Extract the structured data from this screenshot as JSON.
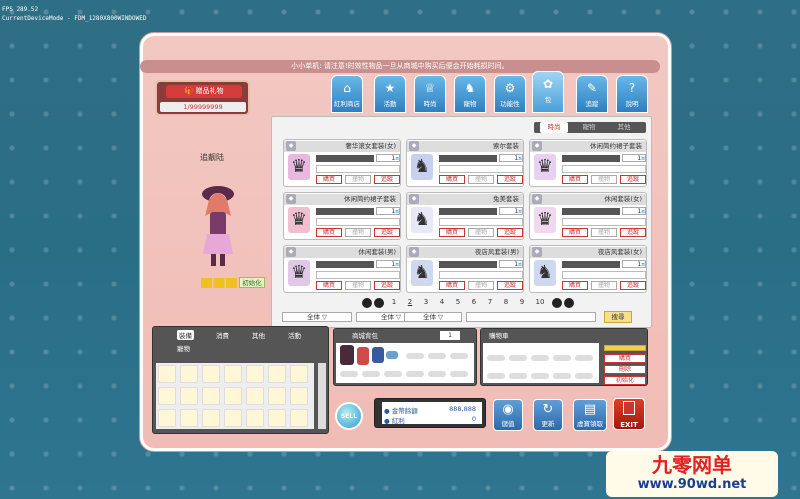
{
  "debug": {
    "fps": "FPS   289.52",
    "mode": "CurrentDeviceMode  - FDM_1280X800WINDOWED"
  },
  "notice": "小小单机: 请注意!时效性物品一旦从商城中购买后便会开始耗损时间。",
  "gift": {
    "label": "赠品礼物",
    "count": "1/99999999"
  },
  "tabs": [
    {
      "label": "紅利商店",
      "icon": "shop-icon"
    },
    {
      "label": "活動",
      "icon": "event-icon"
    },
    {
      "label": "時尚",
      "icon": "hanger-icon"
    },
    {
      "label": "寵物",
      "icon": "pet-icon"
    },
    {
      "label": "功能性",
      "icon": "gear-icon"
    },
    {
      "label": "包",
      "icon": "package-icon"
    },
    {
      "label": "追蹤",
      "icon": "bookmark-icon"
    },
    {
      "label": "說明",
      "icon": "help-icon"
    }
  ],
  "filters": [
    "時尚",
    "寵物",
    "其他"
  ],
  "items": [
    {
      "name": "奢华滚女套装(女)",
      "price": "1",
      "buy": "購買",
      "gift": "撞物",
      "track": "追蹤"
    },
    {
      "name": "索尔套装",
      "price": "1",
      "buy": "購買",
      "gift": "撞物",
      "track": "追蹤"
    },
    {
      "name": "休闲简约裙子套装",
      "price": "1",
      "buy": "購買",
      "gift": "撞物",
      "track": "追蹤"
    },
    {
      "name": "休闲简约裙子套装",
      "price": "1",
      "buy": "購買",
      "gift": "撞物",
      "track": "追蹤"
    },
    {
      "name": "兔美套装",
      "price": "1",
      "buy": "購買",
      "gift": "撞物",
      "track": "追蹤"
    },
    {
      "name": "休闲套装(女)",
      "price": "1",
      "buy": "購買",
      "gift": "撞物",
      "track": "追蹤"
    },
    {
      "name": "休闲套装(男)",
      "price": "1",
      "buy": "購買",
      "gift": "撞物",
      "track": "追蹤"
    },
    {
      "name": "夜店风套装(男)",
      "price": "1",
      "buy": "購買",
      "gift": "撞物",
      "track": "追蹤"
    },
    {
      "name": "夜店风套装(女)",
      "price": "1",
      "buy": "購買",
      "gift": "撞物",
      "track": "追蹤"
    }
  ],
  "pages": [
    "1",
    "2",
    "3",
    "4",
    "5",
    "6",
    "7",
    "8",
    "9",
    "10"
  ],
  "current_page": "2",
  "dropdowns": [
    "全体",
    "全体",
    "全体"
  ],
  "search_button": "搜尋",
  "character": {
    "name": "追靓陆",
    "init_button": "初始化"
  },
  "inventory": {
    "tabs": [
      "裝備",
      "消費",
      "其他",
      "活動"
    ],
    "sub": "寵物"
  },
  "sell": "SELL",
  "store": {
    "label": "商城背包",
    "page": "1"
  },
  "cart": {
    "label": "購物車",
    "buttons": [
      "購買",
      "刪除",
      "初始化"
    ]
  },
  "coins": [
    {
      "label": "金幣餘額",
      "value": "888,888"
    },
    {
      "label": "紅利",
      "value": "0"
    }
  ],
  "actions": [
    {
      "label": "儲值",
      "icon": "coin-icon"
    },
    {
      "label": "更新",
      "icon": "refresh-icon"
    },
    {
      "label": "虛寶領取",
      "icon": "chest-icon"
    }
  ],
  "exit": "EXIT",
  "watermark": {
    "title": "九零网单",
    "url": "www.90wd.net"
  },
  "colors": {
    "tab": "#2f7fc0",
    "accent": "#c33333",
    "window": "#f0bcb5"
  }
}
